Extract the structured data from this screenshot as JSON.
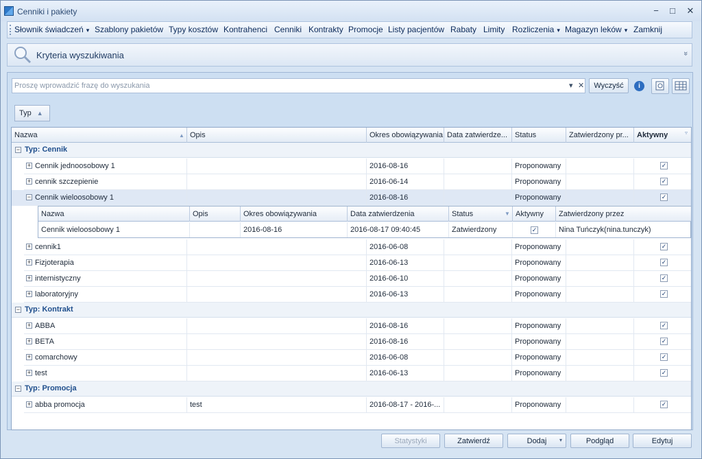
{
  "window": {
    "title": "Cenniki i pakiety",
    "min": "−",
    "max": "□",
    "close": "✕"
  },
  "menu": {
    "items": [
      {
        "label": "Słownik świadczeń",
        "arrow": "▾"
      },
      {
        "label": "Szablony pakietów"
      },
      {
        "label": "Typy kosztów"
      },
      {
        "label": "Kontrahenci"
      },
      {
        "label": "Cenniki"
      },
      {
        "label": "Kontrakty"
      },
      {
        "label": "Promocje"
      },
      {
        "label": "Listy pacjentów"
      },
      {
        "label": "Rabaty"
      },
      {
        "label": "Limity"
      },
      {
        "label": "Rozliczenia",
        "arrow": "▾"
      },
      {
        "label": "Magazyn leków",
        "arrow": "▾"
      },
      {
        "label": "Zamknij"
      }
    ]
  },
  "criteria": {
    "title": "Kryteria wyszukiwania",
    "chevron": "»"
  },
  "search": {
    "placeholder": "Proszę wprowadzić frazę do wyszukania",
    "dropdown": "▾",
    "clear": "✕",
    "clear_button": "Wyczyść",
    "info": "i"
  },
  "grouping": {
    "label": "Typ",
    "arrow": "▲"
  },
  "grid": {
    "columns": [
      "Nazwa",
      "Opis",
      "Okres obowiązywania",
      "Data zatwierdze...",
      "Status",
      "Zatwierdzony pr...",
      "Aktywny"
    ],
    "groups": [
      {
        "label": "Typ: Cennik",
        "rows": [
          {
            "name": "Cennik jednoosobowy 1",
            "opis": "",
            "okres": "2016-08-16",
            "status": "Proponowany",
            "aktywny": true
          },
          {
            "name": "cennik szczepienie",
            "opis": "",
            "okres": "2016-06-14",
            "status": "Proponowany",
            "aktywny": true
          },
          {
            "name": "Cennik wieloosobowy 1",
            "opis": "",
            "okres": "2016-08-16",
            "status": "Proponowany",
            "aktywny": true,
            "expanded": true
          },
          {
            "name": "cennik1",
            "opis": "",
            "okres": "2016-06-08",
            "status": "Proponowany",
            "aktywny": true
          },
          {
            "name": "Fizjoterapia",
            "opis": "",
            "okres": "2016-06-13",
            "status": "Proponowany",
            "aktywny": true
          },
          {
            "name": "internistyczny",
            "opis": "",
            "okres": "2016-06-10",
            "status": "Proponowany",
            "aktywny": true
          },
          {
            "name": "laboratoryjny",
            "opis": "",
            "okres": "2016-06-13",
            "status": "Proponowany",
            "aktywny": true
          }
        ]
      },
      {
        "label": "Typ: Kontrakt",
        "rows": [
          {
            "name": "ABBA",
            "opis": "",
            "okres": "2016-08-16",
            "status": "Proponowany",
            "aktywny": true
          },
          {
            "name": "BETA",
            "opis": "",
            "okres": "2016-08-16",
            "status": "Proponowany",
            "aktywny": true
          },
          {
            "name": "comarchowy",
            "opis": "",
            "okres": "2016-06-08",
            "status": "Proponowany",
            "aktywny": true
          },
          {
            "name": "test",
            "opis": "",
            "okres": "2016-06-13",
            "status": "Proponowany",
            "aktywny": true
          }
        ]
      },
      {
        "label": "Typ: Promocja",
        "rows": [
          {
            "name": "abba promocja",
            "opis": "test",
            "okres": "2016-08-17 - 2016-...",
            "status": "Proponowany",
            "aktywny": true
          }
        ]
      }
    ],
    "detail": {
      "columns": [
        "Nazwa",
        "Opis",
        "Okres obowiązywania",
        "Data zatwierdzenia",
        "Status",
        "Aktywny",
        "Zatwierdzony przez"
      ],
      "row": {
        "name": "Cennik wieloosobowy 1",
        "opis": "",
        "okres": "2016-08-16",
        "data": "2016-08-17 09:40:45",
        "status": "Zatwierdzony",
        "aktywny": true,
        "przez": "Nina Tuńczyk(nina.tunczyk)"
      }
    }
  },
  "buttons": {
    "stats": "Statystyki",
    "approve": "Zatwierdź",
    "add": "Dodaj",
    "preview": "Podgląd",
    "edit": "Edytuj"
  }
}
